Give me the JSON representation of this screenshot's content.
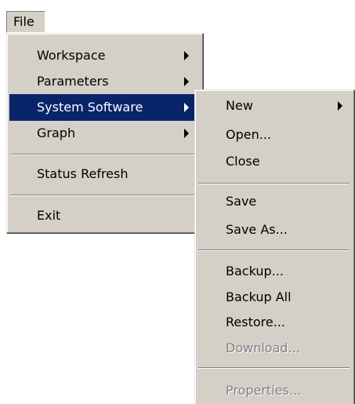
{
  "menubar": {
    "file_label": "File"
  },
  "file_menu": {
    "workspace": "Workspace",
    "parameters": "Parameters",
    "system_software": "System Software",
    "graph": "Graph",
    "status_refresh": "Status Refresh",
    "exit": "Exit"
  },
  "system_software_menu": {
    "new": "New",
    "open": "Open...",
    "close": "Close",
    "save": "Save",
    "save_as": "Save As...",
    "backup": "Backup...",
    "backup_all": "Backup All",
    "restore": "Restore...",
    "download": "Download...",
    "properties": "Properties..."
  },
  "colors": {
    "menu_background": "#d4d0c8",
    "highlight": "#0a246a",
    "disabled_text": "#808080"
  }
}
